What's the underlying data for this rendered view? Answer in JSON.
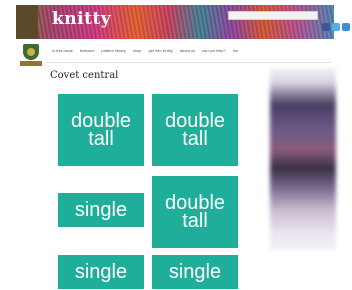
{
  "header": {
    "brand": "knitty"
  },
  "nav": {
    "items": [
      "in this issue",
      "features",
      "pattern library",
      "shop",
      "get into Knitty",
      "about us",
      "can we help?",
      "fun"
    ]
  },
  "page": {
    "title": "Covet central"
  },
  "tiles": [
    {
      "label": "double\ntall"
    },
    {
      "label": "double\ntall"
    },
    {
      "label": "single"
    },
    {
      "label": "double\ntall"
    },
    {
      "label": "single"
    },
    {
      "label": "single"
    }
  ],
  "colors": {
    "tile": "#1fae9a"
  }
}
